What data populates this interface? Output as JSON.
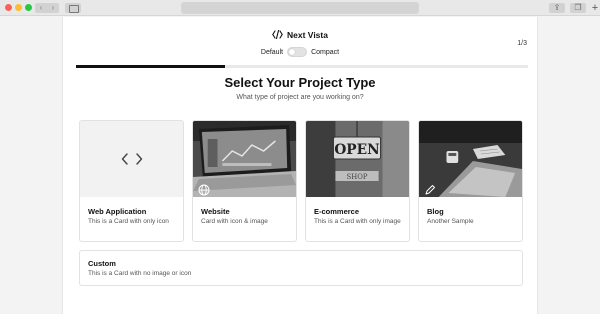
{
  "brand": {
    "name": "Next Vista",
    "icon": "code-icon"
  },
  "view_toggle": {
    "left_label": "Default",
    "right_label": "Compact",
    "state": "off"
  },
  "step": {
    "text": "1/3",
    "progress": 0.33
  },
  "heading": "Select Your Project Type",
  "subheading": "What type of project are you working on?",
  "cards": [
    {
      "title": "Web Application",
      "desc": "This is a Card with only icon",
      "icon": "code-icon"
    },
    {
      "title": "Website",
      "desc": "Card with icon & image",
      "icon": "globe-icon",
      "image": "laptop-dashboard-photo"
    },
    {
      "title": "E-commerce",
      "desc": "This is a Card with only image",
      "image": "open-shop-sign-photo"
    },
    {
      "title": "Blog",
      "desc": "Another Sample",
      "icon": "pencil-icon",
      "image": "desk-laptop-coffee-photo"
    }
  ],
  "custom": {
    "title": "Custom",
    "desc": "This is a Card with no image or icon"
  },
  "photo_text": {
    "shop_sign": "OPEN",
    "shop_sign_sub": "SHOP"
  },
  "chrome": {
    "nav_back": "‹",
    "nav_forward": "›",
    "new_tab": "+"
  }
}
